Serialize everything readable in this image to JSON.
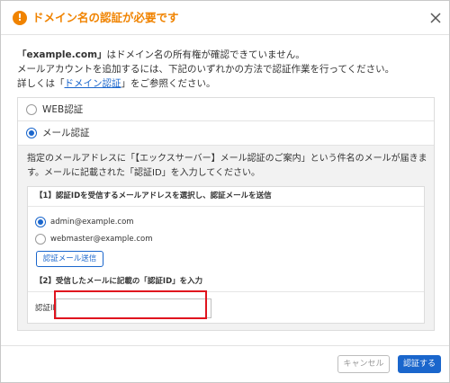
{
  "dialog": {
    "title": "ドメイン名の認証が必要です",
    "warning_icon_glyph": "!",
    "intro": {
      "domain": "「example.com」",
      "line1_rest": "はドメイン名の所有権が確認できていません。",
      "line2": "メールアカウントを追加するには、下記のいずれかの方法で認証作業を行ってください。",
      "line3_prefix": "詳しくは「",
      "line3_link": "ドメイン認証",
      "line3_suffix": "」をご参照ください。"
    },
    "options": {
      "web_label": "WEB認証",
      "web_selected": false,
      "mail_label": "メール認証",
      "mail_selected": true
    },
    "mail_auth": {
      "description": "指定のメールアドレスに「【エックスサーバー】メール認証のご案内」という件名のメールが届きます。メールに記載された「認証ID」を入力してください。",
      "step1_heading": "【1】認証IDを受信するメールアドレスを選択し、認証メールを送信",
      "addresses": [
        {
          "label": "admin@example.com",
          "selected": true
        },
        {
          "label": "webmaster@example.com",
          "selected": false
        }
      ],
      "send_button": "認証メール送信",
      "step2_heading": "【2】受信したメールに記載の「認証ID」を入力",
      "id_label": "認証ID",
      "id_value": ""
    },
    "footer": {
      "cancel": "キャンセル",
      "submit": "認証する"
    }
  },
  "colors": {
    "accent_orange": "#f08300",
    "primary_blue": "#1a66cc",
    "highlight_red": "#e0141e"
  }
}
